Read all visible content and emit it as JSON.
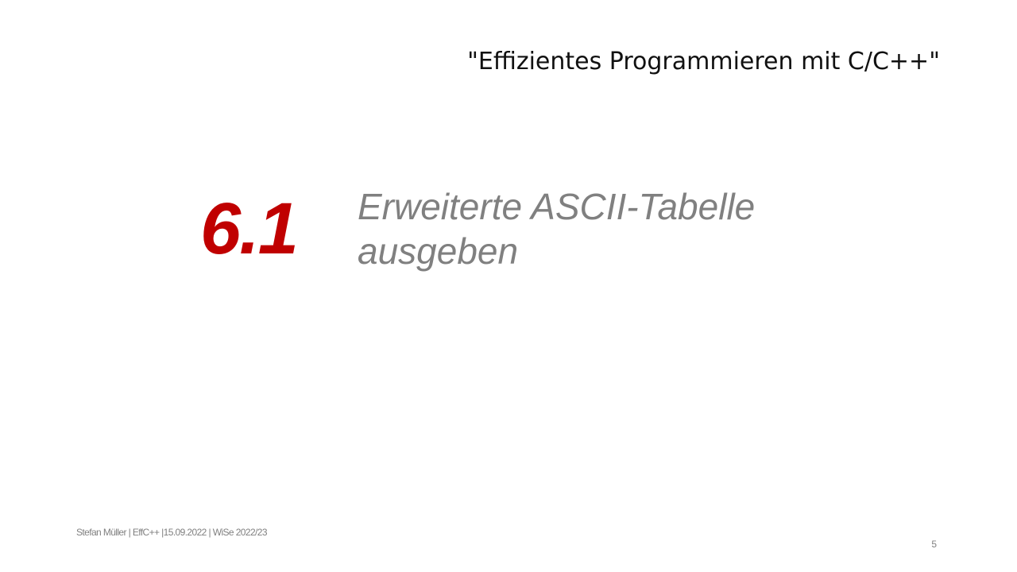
{
  "header": {
    "course_title": "\"Effizientes Programmieren mit C/C++\""
  },
  "section": {
    "number": "6.1",
    "title_line_1": "Erweiterte ASCII-Tabelle",
    "title_line_2": "ausgeben"
  },
  "footer": {
    "text": "Stefan Müller | EffC++ |15.09.2022 | WiSe 2022/23",
    "page_number": "5"
  },
  "colors": {
    "section_number": "#c00000",
    "section_title": "#808080",
    "course_title": "#111111",
    "footer": "#808080",
    "background": "#ffffff"
  }
}
